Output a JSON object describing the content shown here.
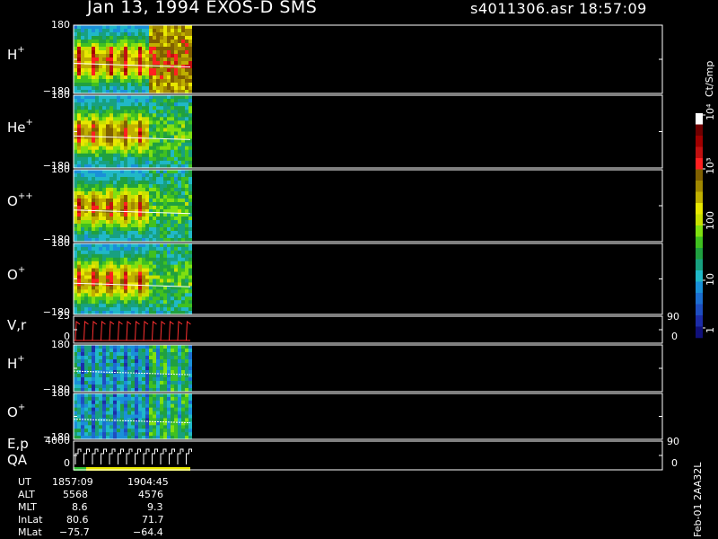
{
  "header": {
    "date_instrument": "Jan 13, 1994   EXOS-D SMS",
    "file_time": "s4011306.asr  18:57:09"
  },
  "colors": {
    "background": "#000000",
    "frame": "#ffffff",
    "trace": "#ff3030"
  },
  "panels": [
    {
      "id": "p1",
      "label": "H",
      "sup": "+",
      "ymax": "180",
      "ymin": "−180"
    },
    {
      "id": "p2",
      "label": "He",
      "sup": "+",
      "ymax": "180",
      "ymin": "−180"
    },
    {
      "id": "p3",
      "label": "O",
      "sup": "++",
      "ymax": "180",
      "ymin": "−180"
    },
    {
      "id": "p4",
      "label": "O",
      "sup": "+",
      "ymax": "180",
      "ymin": "−180"
    },
    {
      "id": "p5",
      "label": "V,r",
      "sup": "",
      "ymax": "25",
      "ymin": "0",
      "rmax": "90",
      "rmin": "0"
    },
    {
      "id": "p6",
      "label": "H",
      "sup": "+",
      "ymax": "180",
      "ymin": "−180"
    },
    {
      "id": "p7",
      "label": "O",
      "sup": "+",
      "ymax": "180",
      "ymin": "−180"
    },
    {
      "id": "p8",
      "label": "E,p",
      "label2": "QA",
      "sup": "",
      "ymax": "4000",
      "ymin": "0",
      "rmax": "90",
      "rmin": "0"
    }
  ],
  "colorbar": {
    "unit": "Ct/Smp",
    "labels": [
      "1",
      "10",
      "100",
      "10³",
      "10⁴"
    ],
    "colors": [
      "#10107a",
      "#1c2ca8",
      "#1e4ec0",
      "#1c6ed0",
      "#1a90d8",
      "#20b8c8",
      "#18a080",
      "#20a040",
      "#40c020",
      "#80e010",
      "#c8e000",
      "#e8e800",
      "#c0b000",
      "#a08800",
      "#806000",
      "#ff2020",
      "#c01010",
      "#a00000",
      "#700000",
      "#ffffff"
    ]
  },
  "ephemeris": {
    "rows": [
      {
        "label": "UT",
        "v1": "1857:09",
        "v2": "1904:45"
      },
      {
        "label": "ALT",
        "v1": "5568",
        "v2": "4576"
      },
      {
        "label": "MLT",
        "v1": "8.6",
        "v2": "9.3"
      },
      {
        "label": "InLat",
        "v1": "80.6",
        "v2": "71.7"
      },
      {
        "label": "MLat",
        "v1": "−75.7",
        "v2": "−64.4"
      }
    ]
  },
  "footer": {
    "plot_id": "Feb-01 2AA32L"
  },
  "chart_data": {
    "type": "heatmap",
    "title": "Jan 13, 1994   EXOS-D SMS",
    "subtitle": "s4011306.asr  18:57:09",
    "x": {
      "label": "UT",
      "ticks": [
        "1857:09",
        "1904:45"
      ]
    },
    "panels": [
      {
        "name": "H+",
        "ylim": [
          -180,
          180
        ]
      },
      {
        "name": "He+",
        "ylim": [
          -180,
          180
        ]
      },
      {
        "name": "O++",
        "ylim": [
          -180,
          180
        ]
      },
      {
        "name": "O+",
        "ylim": [
          -180,
          180
        ]
      },
      {
        "name": "V,r",
        "ylim": [
          0,
          25
        ],
        "y2lim": [
          0,
          90
        ]
      },
      {
        "name": "H+",
        "ylim": [
          -180,
          180
        ]
      },
      {
        "name": "O+",
        "ylim": [
          -180,
          180
        ]
      },
      {
        "name": "E,p",
        "ylim": [
          0,
          4000
        ],
        "y2lim": [
          0,
          90
        ]
      }
    ],
    "colorbar": {
      "label": "Ct/Smp",
      "scale": "log",
      "range": [
        1,
        10000
      ]
    },
    "data_coverage_fraction": 0.198
  }
}
